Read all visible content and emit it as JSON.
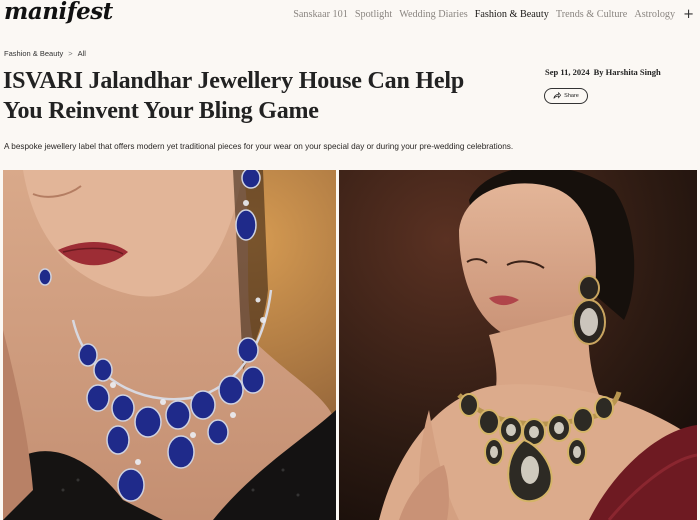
{
  "site": {
    "logo": "manifest"
  },
  "nav": {
    "items": [
      "Sanskaar 101",
      "Spotlight",
      "Wedding Diaries",
      "Fashion & Beauty",
      "Trends & Culture",
      "Astrology"
    ],
    "active": "Fashion & Beauty",
    "more_icon": "plus-icon"
  },
  "breadcrumb": {
    "section": "Fashion & Beauty",
    "separator": ">",
    "current": "All"
  },
  "article": {
    "title": "ISVARI Jalandhar Jewellery House Can Help You Reinvent Your Bling Game",
    "date": "Sep 11, 2024",
    "author": "By Harshita Singh",
    "share_label": "Share",
    "dek": "A bespoke jewellery label that offers modern yet traditional pieces for your wear on your special day or during your pre-wedding celebrations."
  },
  "images": {
    "left": "model-blue-sapphire-necklace-photo",
    "right": "model-kundan-polki-necklace-photo"
  }
}
